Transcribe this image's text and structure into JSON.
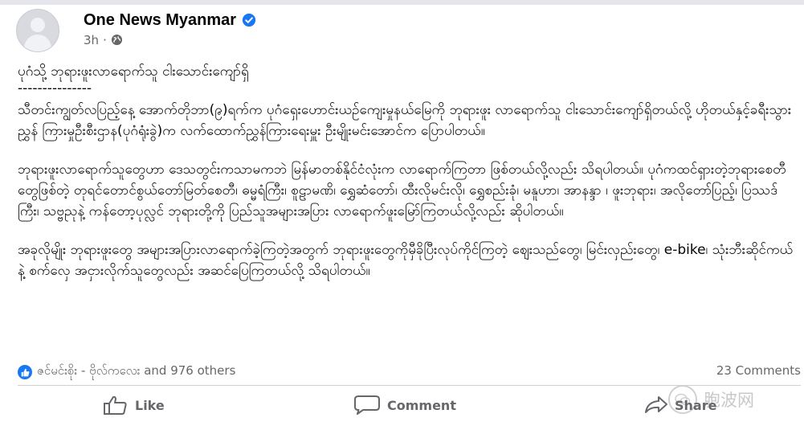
{
  "post": {
    "page_name": "One News Myanmar",
    "time": "3h",
    "separator": "·",
    "title": "ပုဂံသို့ ဘုရားဖူးလာရောက်သူ ငါးသောင်းကျော်ရှိ",
    "rule": "---------------",
    "paragraph1": "သီတင်းကျွတ်လပြည့်နေ့ အောက်တိုဘာ(၉)ရက်က ပုဂံရှေးဟောင်းယဉ်ကျေးမှုနယ်မြေကို ဘုရားဖူး လာရောက်သူ ငါးသောင်းကျော်ရှိတယ်လို့ ဟိုတယ်နှင့်ခရီးသွားညွှန် ကြားမှုဦးစီးဌာန(ပုဂံရုံးခွဲ)က လက်ထောက်ညွှန်ကြားရေးမှူး ဦးမျိုးမင်းအောင်က ပြောပါတယ်။",
    "paragraph2": "ဘုရားဖူးလာရောက်သူတွေဟာ ဒေသတွင်းကသာမကဘဲ မြန်မာတစ်နိုင်ငံလုံးက လာရောက်ကြတာ ဖြစ်တယ်လို့လည်း သိရပါတယ်။ ပုဂံကထင်ရှားတဲ့ဘုရားစေတီတွေဖြစ်တဲ့ တုရင်တောင်စွယ်တော်မြတ်စေတီ၊ ဓမ္မရံကြီး၊ စူဠာမဏိ၊ ရွှေဆံတော်၊ ထီးလိုမင်းလို၊ ရွှေစည်းခုံ၊ မနူဟာ၊ အာနန္ဒာ ၊ ဖူးဘုရား၊ အလိုတော်ပြည့်၊ ပြဿဒ်ကြီး၊ သဗ္ဗညုနဲ့ ကန်တော့ပုလ္လင် ဘုရားတို့ကို ပြည်သူအများအပြား လာရောက်ဖူးမြော်ကြတယ်လို့လည်း ဆိုပါတယ်။",
    "paragraph3": "အခုလိုမျိုး ဘုရားဖူးတွေ အများအပြားလာရောက်ခဲ့ကြတဲ့အတွက် ဘုရားဖူးတွေကိုမှီခိုပြီးလုပ်ကိုင်ကြတဲ့ ဈေးသည်တွေ၊ မြင်းလှည်းတွေ၊ e-bike၊ သုံးဘီးဆိုင်ကယ်နဲ့ စက်လှေ အငှားလိုက်သူတွေလည်း အဆင်ပြေကြတယ်လို့ သိရပါတယ်။"
  },
  "engagement": {
    "reactions_text": "ဇင်မင်းစိုး - ဗိုလ်ကလေး and 976 others",
    "comments_text": "23 Comments"
  },
  "actions": {
    "like_label": "Like",
    "comment_label": "Comment",
    "share_label": "Share"
  },
  "watermark": {
    "text": "胞波网"
  },
  "colors": {
    "accent": "#1877f2",
    "secondary_text": "#65676b",
    "divider": "#ced0d4"
  },
  "icons": [
    "verified-badge-icon",
    "globe-icon",
    "like-reaction-icon",
    "thumbs-up-icon",
    "comment-bubble-icon",
    "share-arrow-icon",
    "wechat-icon"
  ]
}
